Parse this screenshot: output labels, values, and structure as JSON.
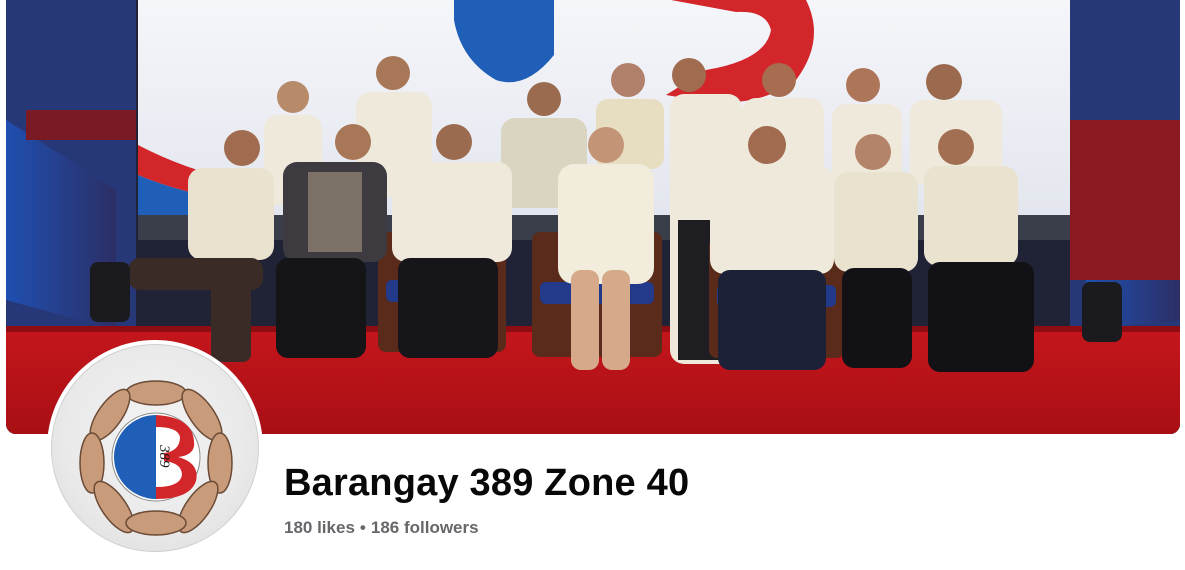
{
  "profile": {
    "name": "Barangay 389 Zone 40",
    "likes": "180 likes",
    "separator": "•",
    "followers": "186 followers"
  },
  "cover": {
    "icon": "group-photo"
  },
  "avatar": {
    "icon": "barangay-logo",
    "logo_text": "389"
  },
  "colors": {
    "stage_red": "#b3141b",
    "logo_blue": "#1f5fb8",
    "logo_red": "#d3262b",
    "text_primary": "#080809",
    "text_secondary": "#65676b"
  }
}
